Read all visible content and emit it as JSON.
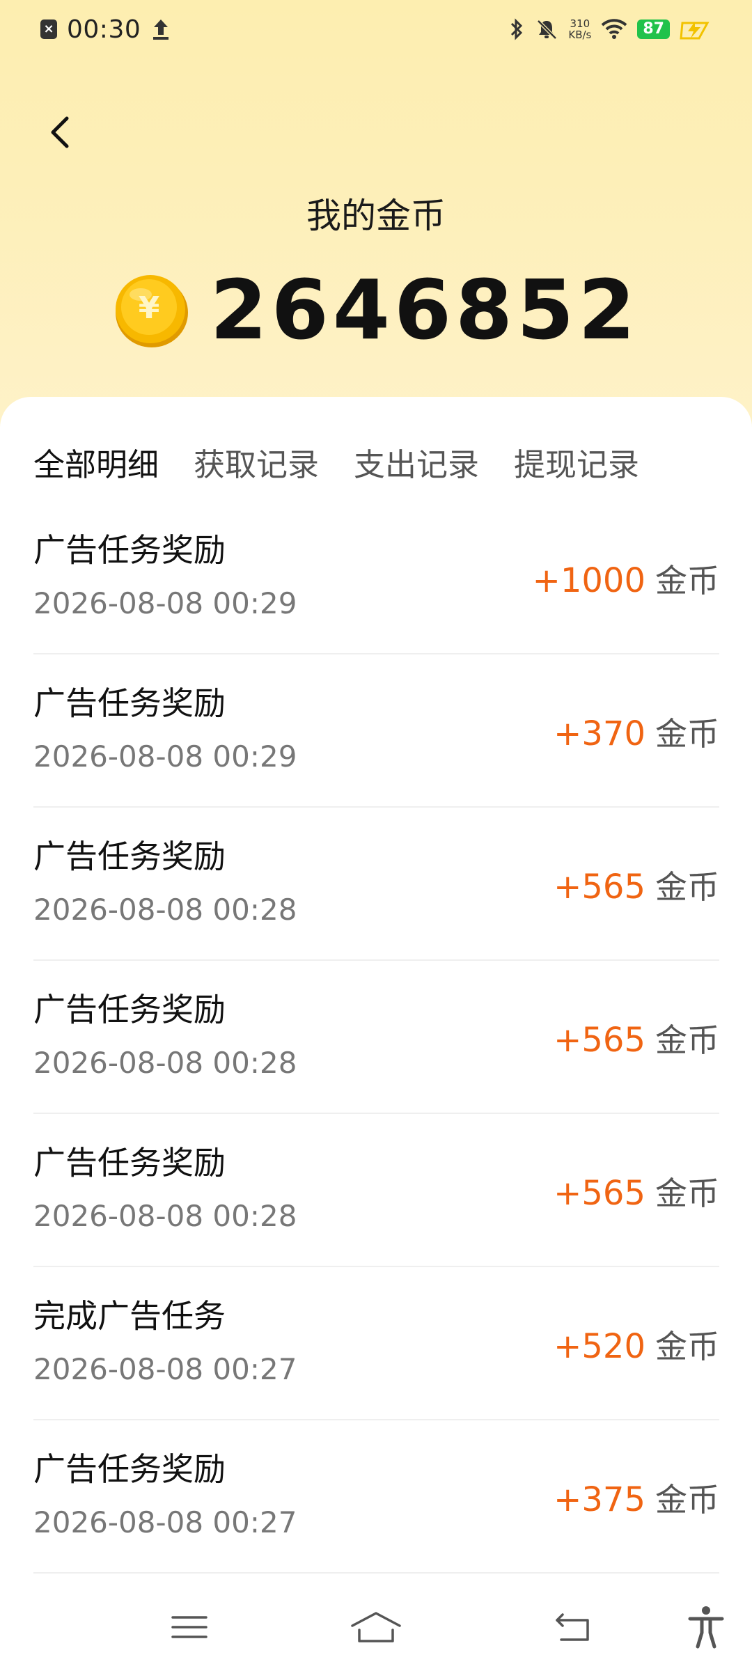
{
  "status_bar": {
    "time": "00:30",
    "net_speed_value": "310",
    "net_speed_unit": "KB/s",
    "battery": "87"
  },
  "header": {
    "title": "我的金币",
    "balance": "2646852",
    "coin_symbol": "¥"
  },
  "tabs": [
    {
      "label": "全部明细",
      "active": true
    },
    {
      "label": "获取记录",
      "active": false
    },
    {
      "label": "支出记录",
      "active": false
    },
    {
      "label": "提现记录",
      "active": false
    }
  ],
  "records": [
    {
      "title": "广告任务奖励",
      "time": "2026-08-08 00:29",
      "amount": "+1000",
      "unit": "金币"
    },
    {
      "title": "广告任务奖励",
      "time": "2026-08-08 00:29",
      "amount": "+370",
      "unit": "金币"
    },
    {
      "title": "广告任务奖励",
      "time": "2026-08-08 00:28",
      "amount": "+565",
      "unit": "金币"
    },
    {
      "title": "广告任务奖励",
      "time": "2026-08-08 00:28",
      "amount": "+565",
      "unit": "金币"
    },
    {
      "title": "广告任务奖励",
      "time": "2026-08-08 00:28",
      "amount": "+565",
      "unit": "金币"
    },
    {
      "title": "完成广告任务",
      "time": "2026-08-08 00:27",
      "amount": "+520",
      "unit": "金币"
    },
    {
      "title": "广告任务奖励",
      "time": "2026-08-08 00:27",
      "amount": "+375",
      "unit": "金币"
    }
  ],
  "colors": {
    "header_bg": "#fdeeb0",
    "amount": "#f06412",
    "battery": "#21c24b",
    "coin": "#f5b400"
  },
  "icons": {
    "back": "back-arrow-icon",
    "coin": "coin-icon",
    "nav": [
      "menu-icon",
      "home-icon",
      "return-icon",
      "accessibility-icon"
    ]
  }
}
